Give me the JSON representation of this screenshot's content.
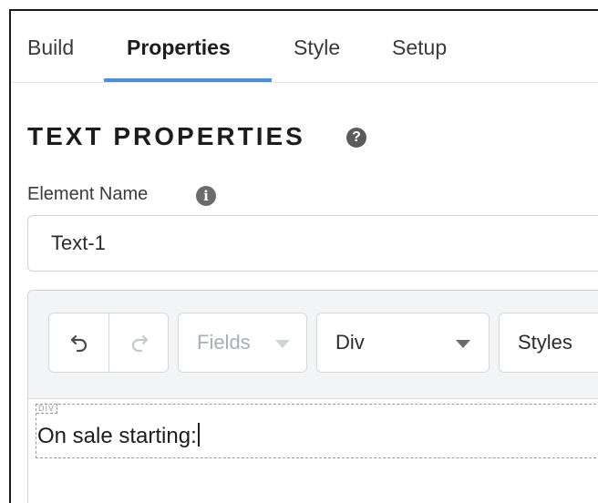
{
  "tabs": [
    {
      "label": "Build",
      "active": false
    },
    {
      "label": "Properties",
      "active": true
    },
    {
      "label": "Style",
      "active": false
    },
    {
      "label": "Setup",
      "active": false
    }
  ],
  "section": {
    "title": "TEXT PROPERTIES",
    "help_icon": "question-circle-icon"
  },
  "element_name": {
    "label": "Element Name",
    "info_icon": "info-circle-icon",
    "value": "Text-1"
  },
  "toolbar": {
    "undo_icon": "undo-icon",
    "redo_icon": "redo-icon",
    "fields_label": "Fields",
    "tag_label": "Div",
    "styles_label": "Styles"
  },
  "content": {
    "tag": "DIV",
    "text": "On sale starting:"
  },
  "colors": {
    "accent": "#4a90e2",
    "toolbar_bg": "#f3f4f6",
    "border": "#cfd3d8"
  }
}
